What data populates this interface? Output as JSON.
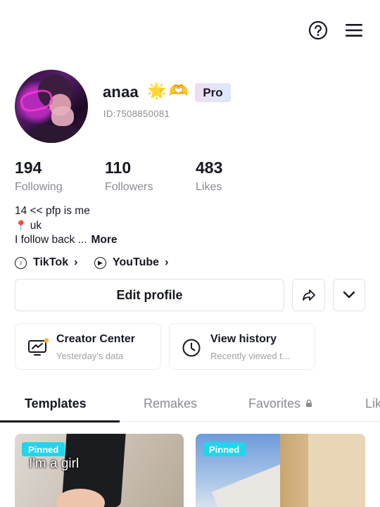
{
  "profile": {
    "username": "anaa",
    "emojis": [
      "🌟",
      "🫶"
    ],
    "badge": "Pro",
    "id_text": "ID:7508850081"
  },
  "stats": [
    {
      "value": "194",
      "label": "Following"
    },
    {
      "value": "110",
      "label": "Followers"
    },
    {
      "value": "483",
      "label": "Likes"
    }
  ],
  "bio": {
    "line1": "14 << pfp is me",
    "pin_icon": "📍",
    "line2": "uk",
    "line3": "I follow back ...",
    "more": "More"
  },
  "links": [
    {
      "label": "TikTok",
      "icon": "tiktok-icon"
    },
    {
      "label": "YouTube",
      "icon": "youtube-icon"
    }
  ],
  "actions": {
    "edit_profile": "Edit profile"
  },
  "cards": [
    {
      "title": "Creator Center",
      "subtitle": "Yesterday's data",
      "icon": "creator-center-icon"
    },
    {
      "title": "View history",
      "subtitle": "Recently viewed t...",
      "icon": "clock-icon"
    }
  ],
  "tabs": [
    {
      "label": "Templates",
      "active": true
    },
    {
      "label": "Remakes",
      "active": false
    },
    {
      "label": "Favorites",
      "active": false
    },
    {
      "label": "Lik",
      "active": false
    }
  ],
  "posts": [
    {
      "badge": "Pinned",
      "caption": "I'm a girl"
    },
    {
      "badge": "Pinned",
      "caption": ""
    }
  ],
  "colors": {
    "text": "#161823",
    "muted": "#8a8b91",
    "pinned": "#20d5ec",
    "notification_dot": "#fbb13c"
  }
}
